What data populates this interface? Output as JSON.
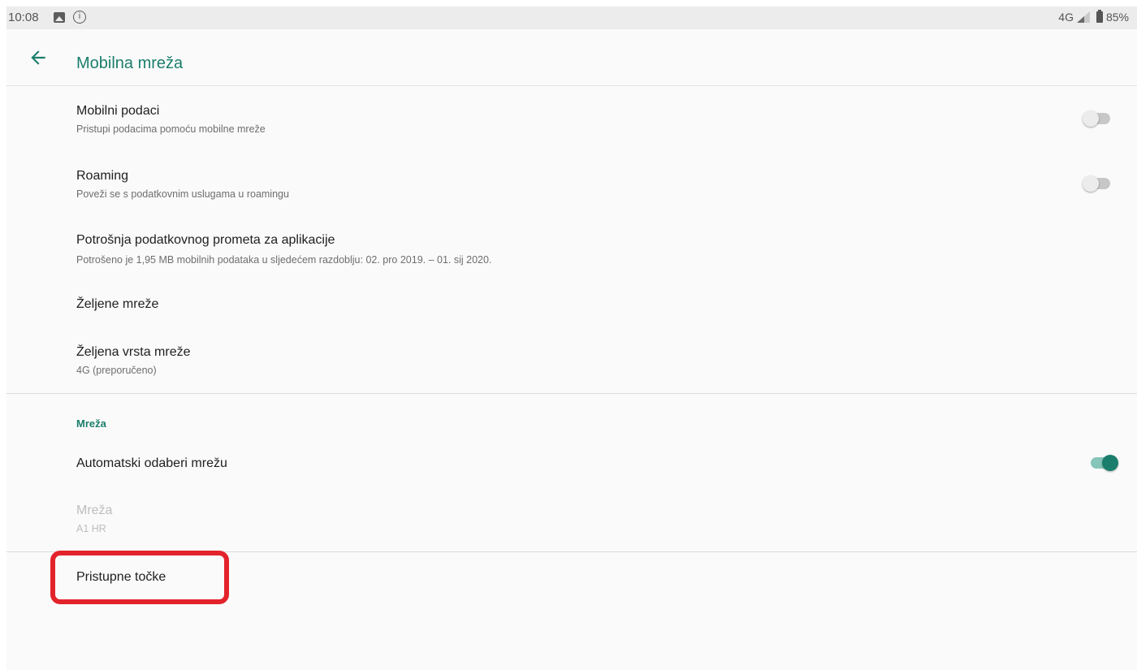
{
  "status_bar": {
    "time": "10:08",
    "network": "4G",
    "battery": "85%",
    "icons": [
      "image-icon",
      "info-icon",
      "signal-icon",
      "battery-icon"
    ]
  },
  "app_bar": {
    "title": "Mobilna mreža",
    "back_icon": "arrow-left-icon"
  },
  "items": [
    {
      "title": "Mobilni podaci",
      "subtitle": "Pristupi podacima pomoću mobilne mreže",
      "switch": "off"
    },
    {
      "title": "Roaming",
      "subtitle": "Poveži se s podatkovnim uslugama u roamingu",
      "switch": "off"
    },
    {
      "title": "Potrošnja podatkovnog prometa za aplikacije",
      "subtitle": "Potrošeno je 1,95 MB mobilnih podataka u sljedećem razdoblju: 02. pro 2019. – 01. sij 2020."
    },
    {
      "title": "Željene mreže"
    },
    {
      "title": "Željena vrsta mreže",
      "subtitle": "4G (preporučeno)"
    }
  ],
  "network_section": {
    "header": "Mreža",
    "items": [
      {
        "title": "Automatski odaberi mrežu",
        "switch": "on"
      },
      {
        "title": "Mreža",
        "subtitle": "A1 HR",
        "disabled": true
      }
    ]
  },
  "access_points": {
    "title": "Pristupne točke",
    "highlighted": true
  },
  "colors": {
    "accent": "#1b7e6c",
    "highlight": "#e3232b"
  }
}
